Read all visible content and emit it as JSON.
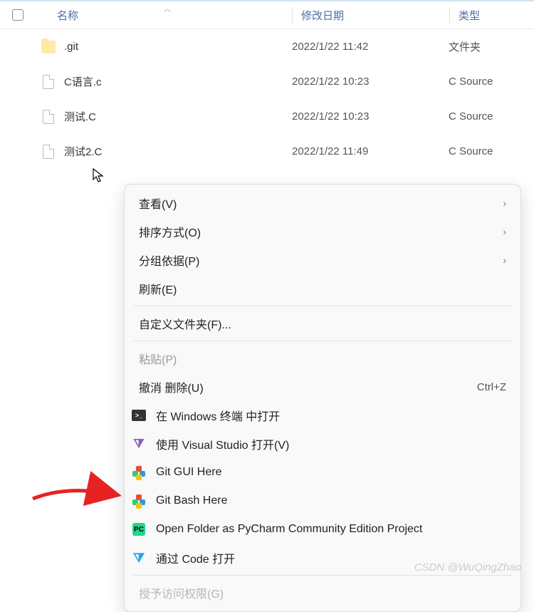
{
  "columns": {
    "name": "名称",
    "date": "修改日期",
    "type": "类型"
  },
  "files": [
    {
      "name": ".git",
      "date": "2022/1/22 11:42",
      "type": "文件夹",
      "icon": "folder"
    },
    {
      "name": "C语言.c",
      "date": "2022/1/22 10:23",
      "type": "C Source",
      "icon": "file"
    },
    {
      "name": "测试.C",
      "date": "2022/1/22 10:23",
      "type": "C Source",
      "icon": "file"
    },
    {
      "name": "测试2.C",
      "date": "2022/1/22 11:49",
      "type": "C Source",
      "icon": "file"
    }
  ],
  "menu": {
    "view": "查看(V)",
    "sort": "排序方式(O)",
    "group": "分组依据(P)",
    "refresh": "刷新(E)",
    "customize": "自定义文件夹(F)...",
    "paste": "粘贴(P)",
    "undo_delete": "撤消 删除(U)",
    "undo_shortcut": "Ctrl+Z",
    "terminal": "在 Windows 终端 中打开",
    "visual_studio": "使用 Visual Studio 打开(V)",
    "git_gui": "Git GUI Here",
    "git_bash": "Git Bash Here",
    "pycharm": "Open Folder as PyCharm Community Edition Project",
    "vscode": "通过 Code 打开",
    "grant_access_partial": "授予访问权限(G)"
  },
  "watermark": "CSDN @WuQingZhao"
}
